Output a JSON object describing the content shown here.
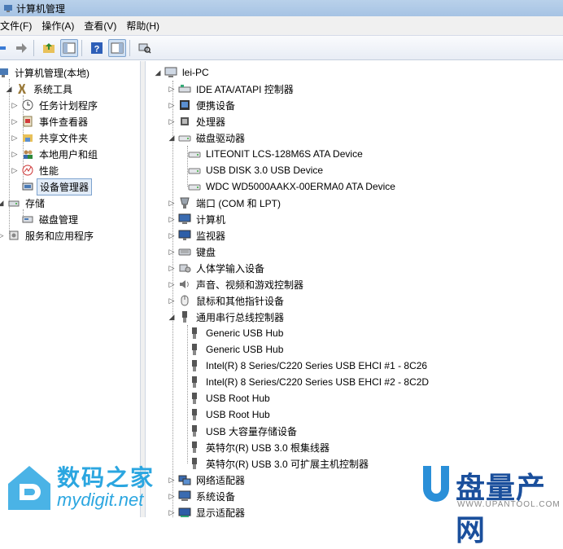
{
  "window": {
    "title": "计算机管理"
  },
  "menu": [
    "文件(F)",
    "操作(A)",
    "查看(V)",
    "帮助(H)"
  ],
  "left_tree": [
    {
      "label": "计算机管理(本地)",
      "icon": "computer-mgmt-icon"
    },
    {
      "label": "系统工具",
      "icon": "tools-icon"
    },
    {
      "label": "任务计划程序",
      "icon": "clock-icon"
    },
    {
      "label": "事件查看器",
      "icon": "event-viewer-icon"
    },
    {
      "label": "共享文件夹",
      "icon": "shared-folder-icon"
    },
    {
      "label": "本地用户和组",
      "icon": "users-icon"
    },
    {
      "label": "性能",
      "icon": "performance-icon"
    },
    {
      "label": "设备管理器",
      "icon": "device-manager-icon"
    },
    {
      "label": "存储",
      "icon": "storage-icon"
    },
    {
      "label": "磁盘管理",
      "icon": "disk-mgmt-icon"
    },
    {
      "label": "服务和应用程序",
      "icon": "services-icon"
    }
  ],
  "device_tree": {
    "root": "lei-PC",
    "items": [
      {
        "label": "IDE ATA/ATAPI 控制器",
        "icon": "ide-icon"
      },
      {
        "label": "便携设备",
        "icon": "portable-device-icon"
      },
      {
        "label": "处理器",
        "icon": "processor-icon"
      },
      {
        "label": "磁盘驱动器",
        "icon": "disk-drive-icon"
      },
      {
        "label": "LITEONIT LCS-128M6S ATA Device",
        "icon": "disk-drive-icon"
      },
      {
        "label": "USB DISK 3.0 USB Device",
        "icon": "disk-drive-icon"
      },
      {
        "label": "WDC WD5000AAKX-00ERMA0 ATA Device",
        "icon": "disk-drive-icon"
      },
      {
        "label": "端口 (COM 和 LPT)",
        "icon": "port-icon"
      },
      {
        "label": "计算机",
        "icon": "computer-icon"
      },
      {
        "label": "监视器",
        "icon": "monitor-icon"
      },
      {
        "label": "键盘",
        "icon": "keyboard-icon"
      },
      {
        "label": "人体学输入设备",
        "icon": "hid-icon"
      },
      {
        "label": "声音、视频和游戏控制器",
        "icon": "sound-icon"
      },
      {
        "label": "鼠标和其他指针设备",
        "icon": "mouse-icon"
      },
      {
        "label": "通用串行总线控制器",
        "icon": "usb-icon"
      },
      {
        "label": "Generic USB Hub",
        "icon": "usb-icon"
      },
      {
        "label": "Generic USB Hub",
        "icon": "usb-icon"
      },
      {
        "label": "Intel(R) 8 Series/C220 Series USB EHCI #1 - 8C26",
        "icon": "usb-icon"
      },
      {
        "label": "Intel(R) 8 Series/C220 Series USB EHCI #2 - 8C2D",
        "icon": "usb-icon"
      },
      {
        "label": "USB Root Hub",
        "icon": "usb-icon"
      },
      {
        "label": "USB Root Hub",
        "icon": "usb-icon"
      },
      {
        "label": "USB 大容量存储设备",
        "icon": "usb-icon"
      },
      {
        "label": "英特尔(R) USB 3.0 根集线器",
        "icon": "usb-icon"
      },
      {
        "label": "英特尔(R) USB 3.0 可扩展主机控制器",
        "icon": "usb-icon"
      },
      {
        "label": "网络适配器",
        "icon": "network-icon"
      },
      {
        "label": "系统设备",
        "icon": "system-device-icon"
      },
      {
        "label": "显示适配器",
        "icon": "display-adapter-icon"
      }
    ]
  },
  "watermarks": {
    "left_cn": "数码之家",
    "left_en": "mydigit.net",
    "right_cn": "盘量产网",
    "right_url": "WWW.UPANTOOL.COM"
  },
  "colors": {
    "selection": "#e2ecf8",
    "selection_border": "#7da2ce",
    "watermark_blue": "#2ba6e0",
    "brand_blue": "#1a4f9c"
  }
}
